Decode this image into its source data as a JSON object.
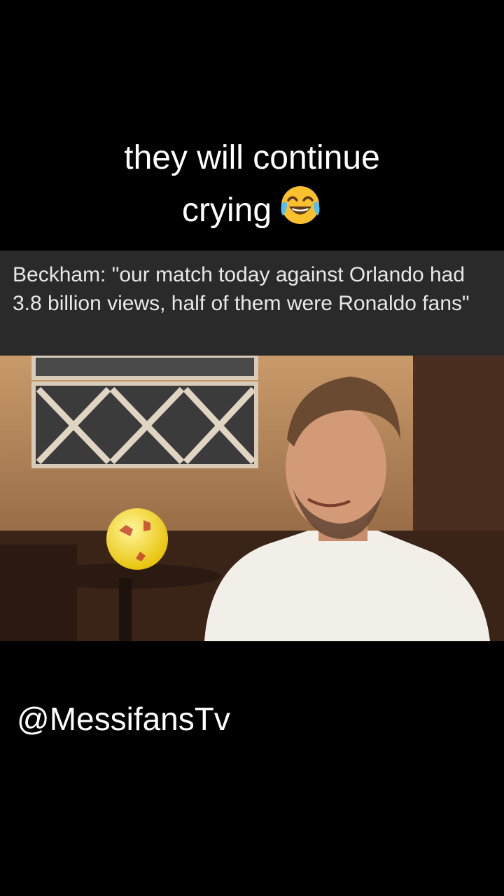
{
  "caption": {
    "line1": "they will continue",
    "line2": "crying",
    "emoji": "face-with-tears-of-joy"
  },
  "quote": {
    "text": "Beckham: \"our match today against Orlando had 3.8 billion views, half of them were Ronaldo fans\""
  },
  "photo": {
    "subject": "interview-photo"
  },
  "watermark": {
    "handle": "@MessifansTv"
  },
  "colors": {
    "background": "#000000",
    "quote_bar": "#2a2a2a",
    "text": "#ffffff"
  }
}
